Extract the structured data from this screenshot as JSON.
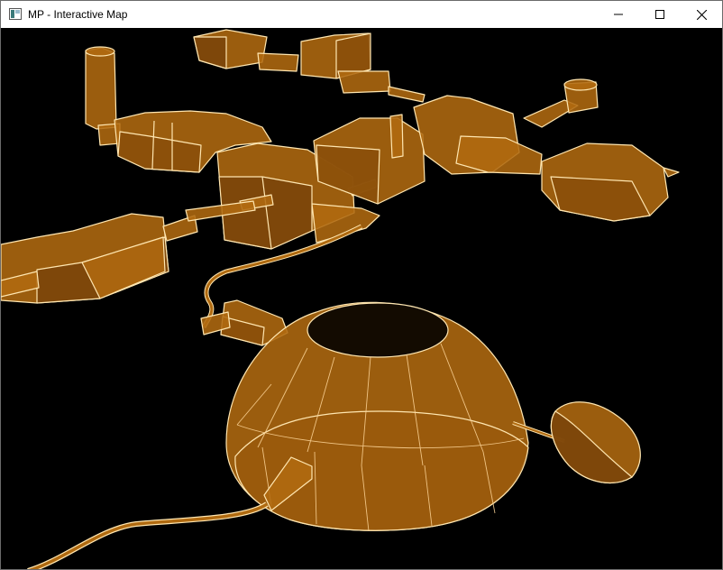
{
  "window": {
    "title": "MP - Interactive Map",
    "controls": {
      "minimize": "minimize-icon",
      "maximize": "maximize-icon",
      "close": "close-icon"
    }
  },
  "viewport": {
    "background": "#000000",
    "map_fill": "#b06a10",
    "map_fill_dark": "#6a3c06",
    "map_edge": "#ffe6b0"
  }
}
